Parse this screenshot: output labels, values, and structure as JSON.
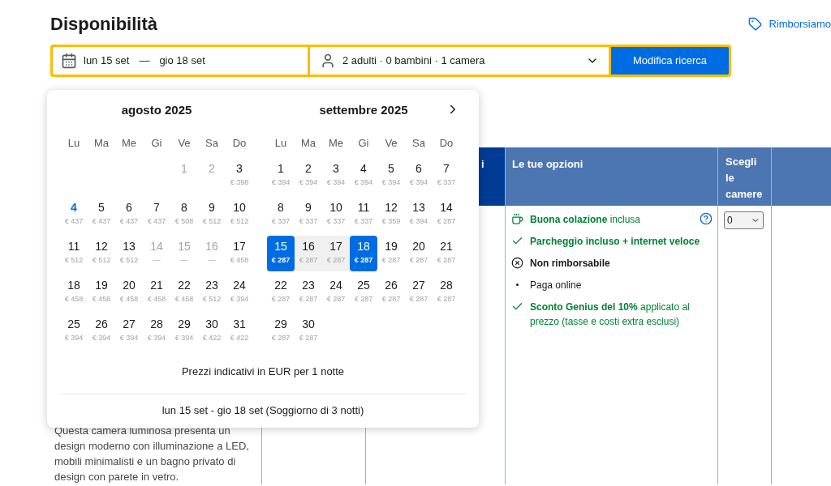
{
  "title": "Disponibilità",
  "refund_link": "Rimborsiamo",
  "search": {
    "dates": {
      "checkin": "lun 15 set",
      "separator": "—",
      "checkout": "gio 18 set"
    },
    "guests": "2 adulti · 0 bambini · 1 camera",
    "button": "Modifica ricerca"
  },
  "calendar": {
    "months": [
      {
        "title": "agosto 2025",
        "first_week_at_end": true,
        "weekdays": [
          "Lu",
          "Ma",
          "Me",
          "Gi",
          "Ve",
          "Sa",
          "Do"
        ],
        "weeks": [
          [
            {
              "day": "1",
              "kind": "past",
              "selected": false
            },
            {
              "day": "2",
              "kind": "past",
              "selected": false
            },
            {
              "day": "3",
              "price": "€ 398",
              "kind": "normal",
              "selected": false
            }
          ],
          [
            {
              "day": "4",
              "price": "€ 437",
              "kind": "today",
              "selected": false
            },
            {
              "day": "5",
              "price": "€ 437",
              "kind": "normal",
              "selected": false
            },
            {
              "day": "6",
              "price": "€ 437",
              "kind": "normal",
              "selected": false
            },
            {
              "day": "7",
              "price": "€ 437",
              "kind": "normal",
              "selected": false
            },
            {
              "day": "8",
              "price": "€ 508",
              "kind": "normal",
              "selected": false
            },
            {
              "day": "9",
              "price": "€ 512",
              "kind": "normal",
              "selected": false
            },
            {
              "day": "10",
              "price": "€ 512",
              "kind": "normal",
              "selected": false
            }
          ],
          [
            {
              "day": "11",
              "price": "€ 512",
              "kind": "normal",
              "selected": false
            },
            {
              "day": "12",
              "price": "€ 512",
              "kind": "normal",
              "selected": false
            },
            {
              "day": "13",
              "price": "€ 512",
              "kind": "normal",
              "selected": false
            },
            {
              "day": "14",
              "price": "—",
              "kind": "sold_out",
              "selected": false
            },
            {
              "day": "15",
              "price": "—",
              "kind": "sold_out",
              "selected": false
            },
            {
              "day": "16",
              "price": "—",
              "kind": "sold_out",
              "selected": false
            },
            {
              "day": "17",
              "price": "€ 458",
              "kind": "normal",
              "selected": false
            }
          ],
          [
            {
              "day": "18",
              "price": "€ 458",
              "kind": "normal",
              "selected": false
            },
            {
              "day": "19",
              "price": "€ 458",
              "kind": "normal",
              "selected": false
            },
            {
              "day": "20",
              "price": "€ 458",
              "kind": "normal",
              "selected": false
            },
            {
              "day": "21",
              "price": "€ 458",
              "kind": "normal",
              "selected": false
            },
            {
              "day": "22",
              "price": "€ 458",
              "kind": "normal",
              "selected": false
            },
            {
              "day": "23",
              "price": "€ 512",
              "kind": "normal",
              "selected": false
            },
            {
              "day": "24",
              "price": "€ 394",
              "kind": "normal",
              "selected": false
            }
          ],
          [
            {
              "day": "25",
              "price": "€ 394",
              "kind": "normal",
              "selected": false
            },
            {
              "day": "26",
              "price": "€ 394",
              "kind": "normal",
              "selected": false
            },
            {
              "day": "27",
              "price": "€ 394",
              "kind": "normal",
              "selected": false
            },
            {
              "day": "28",
              "price": "€ 394",
              "kind": "normal",
              "selected": false
            },
            {
              "day": "29",
              "price": "€ 394",
              "kind": "normal",
              "selected": false
            },
            {
              "day": "30",
              "price": "€ 422",
              "kind": "normal",
              "selected": false
            },
            {
              "day": "31",
              "price": "€ 422",
              "kind": "normal",
              "selected": false
            }
          ]
        ]
      },
      {
        "title": "settembre 2025",
        "next": true,
        "weekdays": [
          "Lu",
          "Ma",
          "Me",
          "Gi",
          "Ve",
          "Sa",
          "Do"
        ],
        "weeks": [
          [
            {
              "day": "1",
              "price": "€ 394",
              "kind": "normal",
              "selected": false
            },
            {
              "day": "2",
              "price": "€ 394",
              "kind": "normal",
              "selected": false
            },
            {
              "day": "3",
              "price": "€ 394",
              "kind": "normal",
              "selected": false
            },
            {
              "day": "4",
              "price": "€ 394",
              "kind": "normal",
              "selected": false
            },
            {
              "day": "5",
              "price": "€ 394",
              "kind": "normal",
              "selected": false
            },
            {
              "day": "6",
              "price": "€ 394",
              "kind": "normal",
              "selected": false
            },
            {
              "day": "7",
              "price": "€ 337",
              "kind": "normal",
              "selected": false
            }
          ],
          [
            {
              "day": "8",
              "price": "€ 337",
              "kind": "normal",
              "selected": false
            },
            {
              "day": "9",
              "price": "€ 337",
              "kind": "normal",
              "selected": false
            },
            {
              "day": "10",
              "price": "€ 337",
              "kind": "normal",
              "selected": false
            },
            {
              "day": "11",
              "price": "€ 337",
              "kind": "normal",
              "selected": false
            },
            {
              "day": "12",
              "price": "€ 359",
              "kind": "normal",
              "selected": false
            },
            {
              "day": "13",
              "price": "€ 394",
              "kind": "normal",
              "selected": false
            },
            {
              "day": "14",
              "price": "€ 287",
              "kind": "normal",
              "selected": false
            }
          ],
          [
            {
              "day": "15",
              "price": "€ 287",
              "kind": "normal",
              "selected": true
            },
            {
              "day": "16",
              "price": "€ 287",
              "kind": "in_range",
              "selected": false
            },
            {
              "day": "17",
              "price": "€ 287",
              "kind": "in_range",
              "selected": false
            },
            {
              "day": "18",
              "price": "€ 287",
              "kind": "normal",
              "selected": true
            },
            {
              "day": "19",
              "price": "€ 287",
              "kind": "normal",
              "selected": false
            },
            {
              "day": "20",
              "price": "€ 287",
              "kind": "normal",
              "selected": false
            },
            {
              "day": "21",
              "price": "€ 287",
              "kind": "normal",
              "selected": false
            }
          ],
          [
            {
              "day": "22",
              "price": "€ 287",
              "kind": "normal",
              "selected": false
            },
            {
              "day": "23",
              "price": "€ 287",
              "kind": "normal",
              "selected": false
            },
            {
              "day": "24",
              "price": "€ 287",
              "kind": "normal",
              "selected": false
            },
            {
              "day": "25",
              "price": "€ 287",
              "kind": "normal",
              "selected": false
            },
            {
              "day": "26",
              "price": "€ 287",
              "kind": "normal",
              "selected": false
            },
            {
              "day": "27",
              "price": "€ 287",
              "kind": "normal",
              "selected": false
            },
            {
              "day": "28",
              "price": "€ 287",
              "kind": "normal",
              "selected": false
            }
          ],
          [
            {
              "day": "29",
              "price": "€ 287",
              "kind": "normal",
              "selected": false
            },
            {
              "day": "30",
              "price": "€ 287",
              "kind": "normal",
              "selected": false
            }
          ]
        ]
      }
    ],
    "note": "Prezzi indicativi in EUR per 1 notte",
    "stay": "lun 15 set - gio 18 set (Soggiorno di 3 notti)"
  },
  "table": {
    "columns": [
      {
        "label": "i",
        "kind": "dark"
      },
      {
        "label": "Le tue opzioni",
        "kind": "light"
      },
      {
        "label": "Scegli le camere",
        "kind": "light"
      }
    ],
    "description": "Questa camera luminosa presenta un design moderno con illuminazione a LED, mobili minimalisti e un bagno privato di design con parete in vetro.",
    "options": [
      {
        "kind": "breakfast",
        "text": "**Buona colazione** inclusa",
        "bold": false,
        "help": true
      },
      {
        "kind": "check",
        "text": "Parcheggio incluso + internet veloce",
        "bold": true,
        "help": false
      },
      {
        "kind": "nonrefundable",
        "text": "Non rimborsabile",
        "bold": true,
        "help": false
      },
      {
        "kind": "bullet",
        "text": "Paga online",
        "bold": false,
        "help": false
      },
      {
        "kind": "check",
        "text": "**Sconto Genius del 10%** applicato al prezzo (tasse e costi extra esclusi)",
        "bold": false,
        "help": false
      }
    ],
    "rooms_select": "0"
  }
}
